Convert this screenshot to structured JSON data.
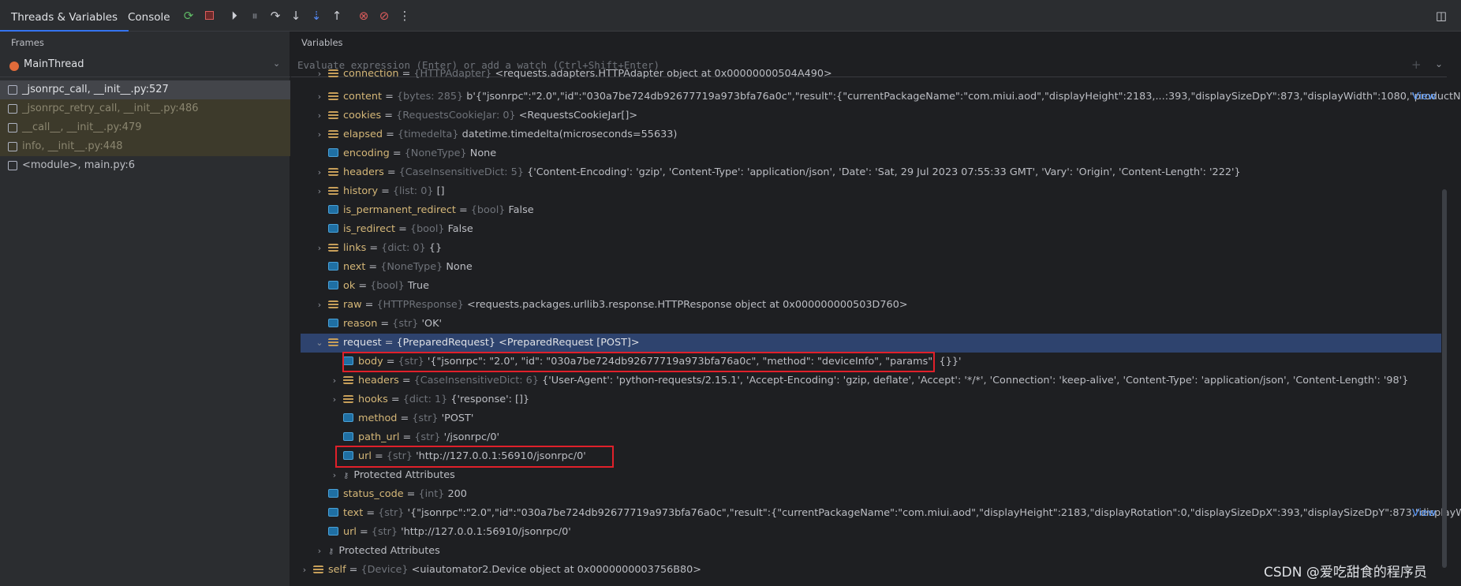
{
  "tabs": {
    "threads": "Threads & Variables",
    "console": "Console"
  },
  "panes": {
    "frames": "Frames",
    "variables": "Variables"
  },
  "thread": "MainThread",
  "eval_placeholder": "Evaluate expression (Enter) or add a watch (Ctrl+Shift+Enter)",
  "frames": [
    "_jsonrpc_call, __init__.py:527",
    "_jsonrpc_retry_call, __init__.py:486",
    "__call__, __init__.py:479",
    "info, __init__.py:448",
    "<module>, main.py:6"
  ],
  "vars": {
    "connection": {
      "name": "connection",
      "type": "{HTTPAdapter}",
      "value": "<requests.adapters.HTTPAdapter object at 0x00000000504A490>"
    },
    "content": {
      "name": "content",
      "type": "{bytes: 285}",
      "value": "b'{\"jsonrpc\":\"2.0\",\"id\":\"030a7be724db92677719a973bfa76a0c\",\"result\":{\"currentPackageName\":\"com.miui.aod\",\"displayHeight\":2183,...:393,\"displaySizeDpY\":873,\"displayWidth\":1080,\"productNar...",
      "link": "View"
    },
    "cookies": {
      "name": "cookies",
      "type": "{RequestsCookieJar: 0}",
      "value": "<RequestsCookieJar[]>"
    },
    "elapsed": {
      "name": "elapsed",
      "type": "{timedelta}",
      "value": "datetime.timedelta(microseconds=55633)"
    },
    "encoding": {
      "name": "encoding",
      "type": "{NoneType}",
      "value": "None"
    },
    "headers": {
      "name": "headers",
      "type": "{CaseInsensitiveDict: 5}",
      "value": "{'Content-Encoding': 'gzip', 'Content-Type': 'application/json', 'Date': 'Sat, 29 Jul 2023 07:55:33 GMT', 'Vary': 'Origin', 'Content-Length': '222'}"
    },
    "history": {
      "name": "history",
      "type": "{list: 0}",
      "value": "[]"
    },
    "is_permanent_redirect": {
      "name": "is_permanent_redirect",
      "type": "{bool}",
      "value": "False"
    },
    "is_redirect": {
      "name": "is_redirect",
      "type": "{bool}",
      "value": "False"
    },
    "links": {
      "name": "links",
      "type": "{dict: 0}",
      "value": "{}"
    },
    "next": {
      "name": "next",
      "type": "{NoneType}",
      "value": "None"
    },
    "ok": {
      "name": "ok",
      "type": "{bool}",
      "value": "True"
    },
    "raw": {
      "name": "raw",
      "type": "{HTTPResponse}",
      "value": "<requests.packages.urllib3.response.HTTPResponse object at 0x000000000503D760>"
    },
    "reason": {
      "name": "reason",
      "type": "{str}",
      "value": "'OK'"
    },
    "request": {
      "name": "request",
      "type": "{PreparedRequest}",
      "value": "<PreparedRequest [POST]>"
    },
    "req_body": {
      "name": "body",
      "type": "{str}",
      "value": "'{\"jsonrpc\": \"2.0\", \"id\": \"030a7be724db92677719a973bfa76a0c\", \"method\": \"deviceInfo\", \"params\": {}}'"
    },
    "req_headers": {
      "name": "headers",
      "type": "{CaseInsensitiveDict: 6}",
      "value": "{'User-Agent': 'python-requests/2.15.1', 'Accept-Encoding': 'gzip, deflate', 'Accept': '*/*', 'Connection': 'keep-alive', 'Content-Type': 'application/json', 'Content-Length': '98'}"
    },
    "req_hooks": {
      "name": "hooks",
      "type": "{dict: 1}",
      "value": "{'response': []}"
    },
    "req_method": {
      "name": "method",
      "type": "{str}",
      "value": "'POST'"
    },
    "req_path_url": {
      "name": "path_url",
      "type": "{str}",
      "value": "'/jsonrpc/0'"
    },
    "req_url": {
      "name": "url",
      "type": "{str}",
      "value": "'http://127.0.0.1:56910/jsonrpc/0'"
    },
    "req_protected": {
      "name": "Protected Attributes"
    },
    "status_code": {
      "name": "status_code",
      "type": "{int}",
      "value": "200"
    },
    "text": {
      "name": "text",
      "type": "{str}",
      "value": "'{\"jsonrpc\":\"2.0\",\"id\":\"030a7be724db92677719a973bfa76a0c\",\"result\":{\"currentPackageName\":\"com.miui.aod\",\"displayHeight\":2183,\"displayRotation\":0,\"displaySizeDpX\":393,\"displaySizeDpY\":873,\"displayWid...",
      "link": "View"
    },
    "url": {
      "name": "url",
      "type": "{str}",
      "value": "'http://127.0.0.1:56910/jsonrpc/0'"
    },
    "protected": {
      "name": "Protected Attributes"
    },
    "self": {
      "name": "self",
      "type": "{Device}",
      "value": "<uiautomator2.Device object at 0x0000000003756B80>"
    }
  },
  "watermark": "CSDN @爱吃甜食的程序员"
}
